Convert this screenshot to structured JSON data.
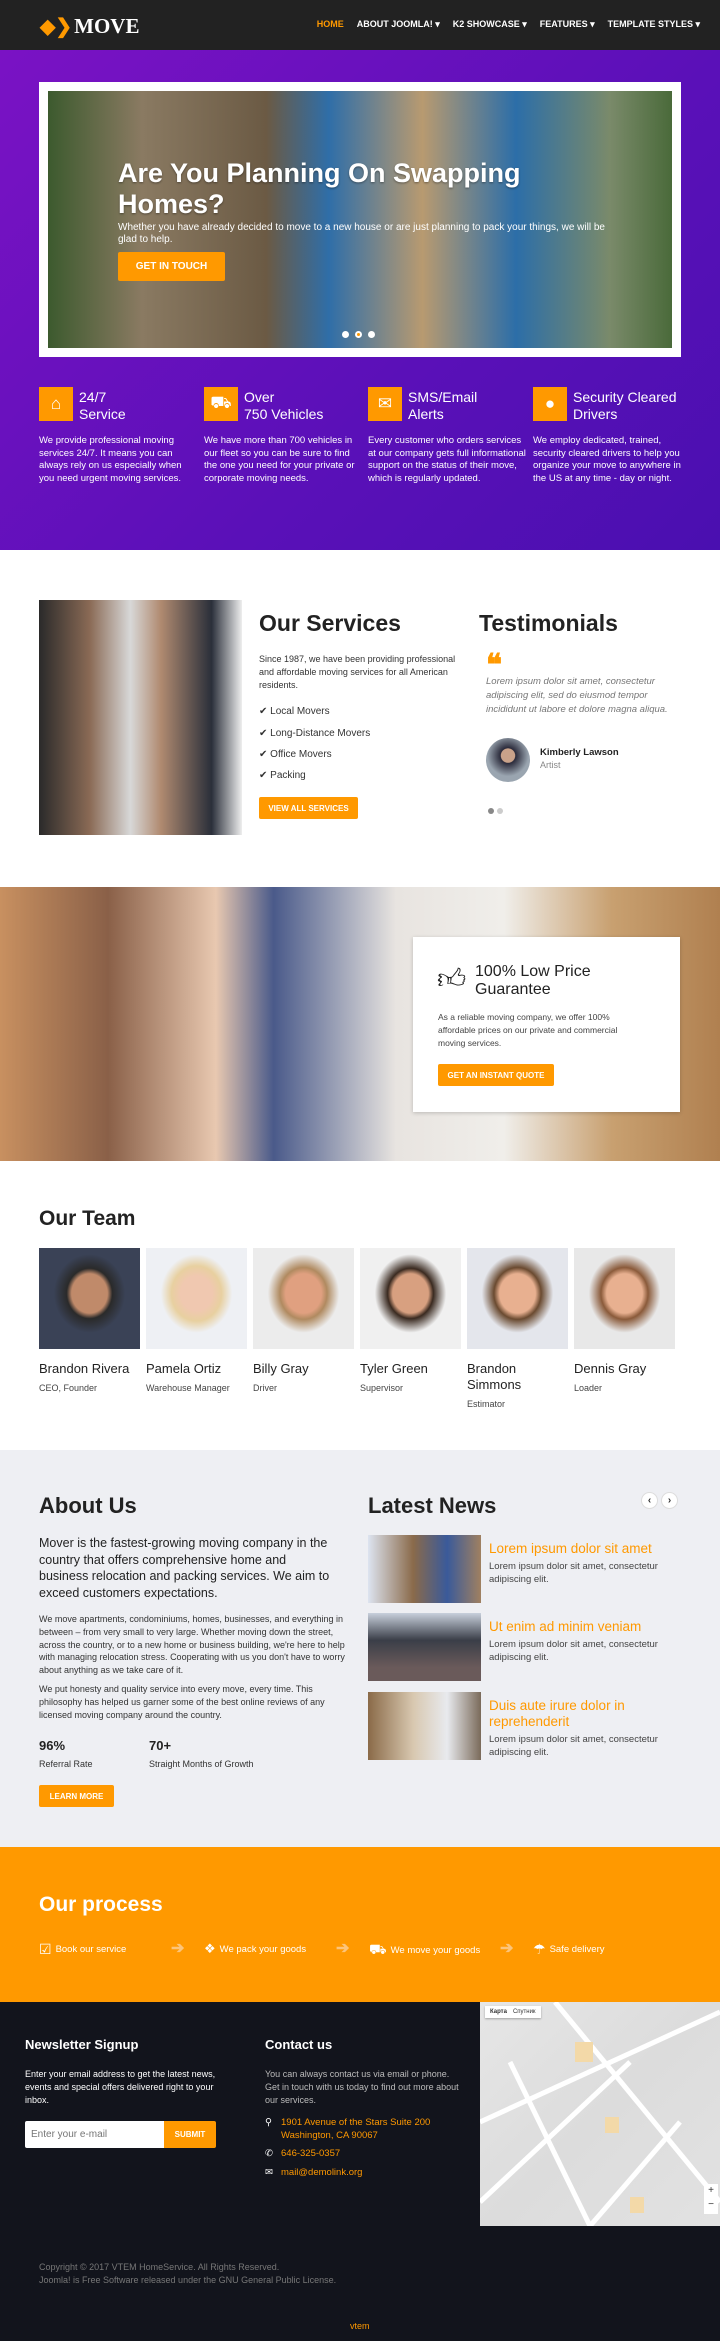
{
  "header": {
    "logo": "MOVE",
    "nav": [
      {
        "label": "HOME",
        "active": true
      },
      {
        "label": "ABOUT JOOMLA! ▾"
      },
      {
        "label": "K2 SHOWCASE ▾"
      },
      {
        "label": "FEATURES ▾"
      },
      {
        "label": "TEMPLATE STYLES ▾"
      }
    ]
  },
  "hero": {
    "title": "Are You Planning On Swapping Homes?",
    "subtitle": "Whether you have already decided to move to a new house or are just planning to pack your things, we will be glad to help.",
    "button": "GET IN TOUCH",
    "slides": 3,
    "active_slide": 2
  },
  "features": [
    {
      "icon": "home-icon",
      "title1": "24/7",
      "title2": "Service",
      "text": "We provide professional moving services 24/7. It means you can always rely on us especially when you need urgent moving services."
    },
    {
      "icon": "truck-icon",
      "title1": "Over",
      "title2": "750 Vehicles",
      "text": "We have more than 700 vehicles in our fleet so you can be sure to find the one you need for your private or corporate moving needs."
    },
    {
      "icon": "envelope-icon",
      "title1": "SMS/Email",
      "title2": "Alerts",
      "text": "Every customer who orders services at our company gets full informational support on the status of their move, which is regularly updated."
    },
    {
      "icon": "user-icon",
      "title1": "Security Cleared",
      "title2": "Drivers",
      "text": "We employ dedicated, trained, security cleared drivers to help you organize your move to anywhere in the US at any time - day or night."
    }
  ],
  "services": {
    "title": "Our Services",
    "text": "Since 1987, we have been providing professional and affordable moving services for all American residents.",
    "items": [
      "Local Movers",
      "Long-Distance Movers",
      "Office Movers",
      "Packing"
    ],
    "button": "VIEW ALL SERVICES"
  },
  "testimonials": {
    "title": "Testimonials",
    "quote": "Lorem ipsum dolor sit amet, consectetur adipiscing elit, sed do eiusmod tempor incididunt ut labore et dolore magna aliqua.",
    "name": "Kimberly Lawson",
    "role": "Artist"
  },
  "guarantee": {
    "title": "100% Low Price Guarantee",
    "text": "As a reliable moving company, we offer 100% affordable prices on our private and commercial moving services.",
    "button": "GET AN INSTANT QUOTE"
  },
  "team": {
    "title": "Our Team",
    "members": [
      {
        "name": "Brandon Rivera",
        "role": "CEO, Founder"
      },
      {
        "name": "Pamela Ortiz",
        "role": "Warehouse Manager"
      },
      {
        "name": "Billy Gray",
        "role": "Driver"
      },
      {
        "name": "Tyler Green",
        "role": "Supervisor"
      },
      {
        "name": "Brandon Simmons",
        "role": "Estimator"
      },
      {
        "name": "Dennis Gray",
        "role": "Loader"
      }
    ]
  },
  "about": {
    "title": "About Us",
    "lead": "Mover is the fastest-growing moving company in the country that offers comprehensive home and business relocation and packing services. We aim to exceed customers expectations.",
    "p1": "We move apartments, condominiums, homes, businesses, and everything in between – from very small to very large. Whether moving down the street, across the country, or to a new home or business building, we're here to help with managing relocation stress. Cooperating with us you don't have to worry about anything as we take care of it.",
    "p2": "We put honesty and quality service into every move, every time. This philosophy has helped us garner some of the best online reviews of any licensed moving company around the country.",
    "stats": [
      {
        "value": "96%",
        "label": "Referral Rate"
      },
      {
        "value": "70+",
        "label": "Straight Months of Growth"
      }
    ],
    "button": "LEARN MORE"
  },
  "news": {
    "title": "Latest News",
    "items": [
      {
        "title": "Lorem ipsum dolor sit amet",
        "text": "Lorem ipsum dolor sit amet, consectetur adipiscing elit."
      },
      {
        "title": "Ut enim ad minim veniam",
        "text": "Lorem ipsum dolor sit amet, consectetur adipiscing elit."
      },
      {
        "title": "Duis aute irure dolor in reprehenderit",
        "text": "Lorem ipsum dolor sit amet, consectetur adipiscing elit."
      }
    ]
  },
  "process": {
    "title": "Our process",
    "steps": [
      "Book our service",
      "We pack your goods",
      "We move your goods",
      "Safe delivery"
    ]
  },
  "newsletter": {
    "title": "Newsletter Signup",
    "text": "Enter your email address to get the latest news, events and special offers delivered right to your inbox.",
    "placeholder": "Enter your e-mail",
    "button": "SUBMIT"
  },
  "contact": {
    "title": "Contact us",
    "text": "You can always contact us via email or phone. Get in touch with us today to find out more about our services.",
    "address1": "1901 Avenue of the Stars Suite 200",
    "address2": "Washington, CA 90067",
    "phone": "646-325-0357",
    "email": "mail@demolink.org"
  },
  "map": {
    "tab_map": "Карта",
    "tab_sat": "Спутник"
  },
  "footer": {
    "copyright": "Copyright © 2017 VTEM HomeService. All Rights Reserved.",
    "license": "Joomla! is Free Software released under the GNU General Public License.",
    "brand": "vtem"
  },
  "colors": {
    "accent": "#ff9900",
    "purple": "#6a12c0",
    "dark": "#12141c"
  }
}
